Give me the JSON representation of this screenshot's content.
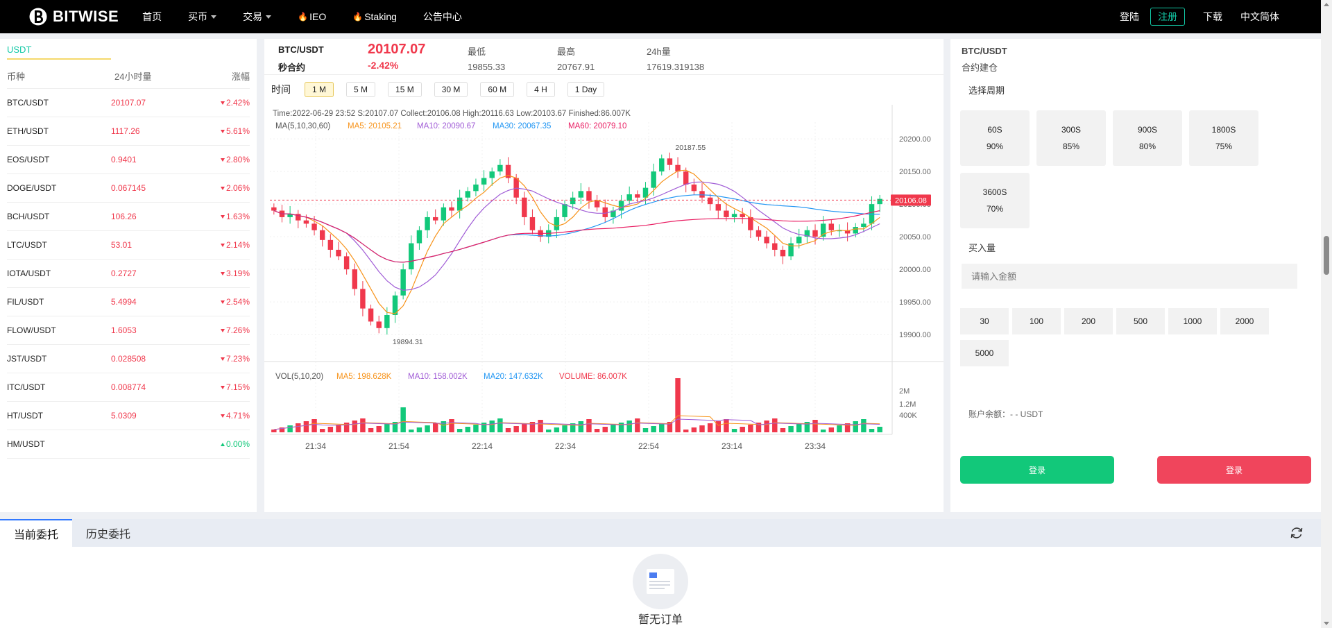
{
  "nav": {
    "logo_text": "BITWISE",
    "items": [
      {
        "label": "首页",
        "caret": false,
        "fire": false
      },
      {
        "label": "买币",
        "caret": true,
        "fire": false
      },
      {
        "label": "交易",
        "caret": true,
        "fire": false
      },
      {
        "label": "IEO",
        "caret": false,
        "fire": true
      },
      {
        "label": "Staking",
        "caret": false,
        "fire": true
      },
      {
        "label": "公告中心",
        "caret": false,
        "fire": false
      }
    ],
    "login": "登陆",
    "register": "注册",
    "download": "下载",
    "language": "中文简体"
  },
  "market": {
    "tab": "USDT",
    "headers": {
      "symbol": "币种",
      "volume": "24小时量",
      "change": "涨幅"
    },
    "rows": [
      {
        "symbol": "BTC/USDT",
        "price": "20107.07",
        "change": "2.42%",
        "dir": "down"
      },
      {
        "symbol": "ETH/USDT",
        "price": "1117.26",
        "change": "5.61%",
        "dir": "down"
      },
      {
        "symbol": "EOS/USDT",
        "price": "0.9401",
        "change": "2.80%",
        "dir": "down"
      },
      {
        "symbol": "DOGE/USDT",
        "price": "0.067145",
        "change": "2.06%",
        "dir": "down"
      },
      {
        "symbol": "BCH/USDT",
        "price": "106.26",
        "change": "1.63%",
        "dir": "down"
      },
      {
        "symbol": "LTC/USDT",
        "price": "53.01",
        "change": "2.14%",
        "dir": "down"
      },
      {
        "symbol": "IOTA/USDT",
        "price": "0.2727",
        "change": "3.19%",
        "dir": "down"
      },
      {
        "symbol": "FIL/USDT",
        "price": "5.4994",
        "change": "2.54%",
        "dir": "down"
      },
      {
        "symbol": "FLOW/USDT",
        "price": "1.6053",
        "change": "7.26%",
        "dir": "down"
      },
      {
        "symbol": "JST/USDT",
        "price": "0.028508",
        "change": "7.23%",
        "dir": "down"
      },
      {
        "symbol": "ITC/USDT",
        "price": "0.008774",
        "change": "7.15%",
        "dir": "down"
      },
      {
        "symbol": "HT/USDT",
        "price": "5.0309",
        "change": "4.71%",
        "dir": "down"
      },
      {
        "symbol": "HM/USDT",
        "price": "",
        "change": "0.00%",
        "dir": "up"
      }
    ]
  },
  "ticker": {
    "pair": "BTC/USDT",
    "type": "秒合约",
    "last": "20107.07",
    "change_pct": "-2.42%",
    "low_label": "最低",
    "low": "19855.33",
    "high_label": "最高",
    "high": "20767.91",
    "vol_label": "24h量",
    "vol": "17619.319138"
  },
  "timeframes": {
    "label": "时间",
    "items": [
      "1 M",
      "5 M",
      "15 M",
      "30 M",
      "60 M",
      "4 H",
      "1 Day"
    ],
    "active": "1 M"
  },
  "chart_data": {
    "type": "candlestick",
    "info_line": "Time:2022-06-29 23:52    S:20107.07    Collect:20106.08    High:20116.63    Low:20103.67  Finished:86.007K",
    "ma_label": "MA(5,10,30,60)",
    "ma_values": [
      {
        "label": "MA5: 20105.21",
        "color": "#f7931a"
      },
      {
        "label": "MA10: 20090.67",
        "color": "#a05cd6"
      },
      {
        "label": "MA30: 20067.35",
        "color": "#2196f3"
      },
      {
        "label": "MA60: 20079.10",
        "color": "#e91e63"
      }
    ],
    "y_ticks": [
      "20200.00",
      "20150.00",
      "20100.00",
      "20050.00",
      "20000.00",
      "19950.00",
      "19900.00"
    ],
    "y_range": [
      19880,
      20215
    ],
    "x_ticks": [
      "21:34",
      "21:54",
      "22:14",
      "22:34",
      "22:54",
      "23:14",
      "23:34"
    ],
    "current_price": "20106.08",
    "max_label": "20187.55",
    "min_label": "19894.31",
    "closes": [
      20090,
      20080,
      20085,
      20075,
      20070,
      20060,
      20045,
      20030,
      20020,
      20000,
      19970,
      19940,
      19920,
      19910,
      19930,
      19960,
      20000,
      20040,
      20060,
      20080,
      20075,
      20095,
      20090,
      20110,
      20120,
      20130,
      20140,
      20150,
      20160,
      20140,
      20110,
      20080,
      20060,
      20050,
      20060,
      20080,
      20100,
      20110,
      20120,
      20105,
      20095,
      20080,
      20090,
      20105,
      20115,
      20110,
      20125,
      20150,
      20170,
      20160,
      20150,
      20130,
      20120,
      20110,
      20100,
      20090,
      20080,
      20085,
      20080,
      20060,
      20050,
      20040,
      20030,
      20020,
      20040,
      20050,
      20060,
      20050,
      20070,
      20060,
      20060,
      20055,
      20065,
      20070,
      20100,
      20108
    ],
    "vol_label": "VOL(5,10,20)",
    "vol_values": [
      {
        "label": "MA5: 198.628K",
        "color": "#f7931a"
      },
      {
        "label": "MA10: 158.002K",
        "color": "#a05cd6"
      },
      {
        "label": "MA20: 147.632K",
        "color": "#2196f3"
      },
      {
        "label": "VOLUME: 86.007K",
        "color": "#f0384c"
      }
    ],
    "vol_ticks": [
      "2M",
      "1.2M",
      "400K"
    ]
  },
  "trade": {
    "pair": "BTC/USDT",
    "sub": "合约建仓",
    "period_label": "选择周期",
    "periods": [
      {
        "time": "60S",
        "rate": "90%"
      },
      {
        "time": "300S",
        "rate": "85%"
      },
      {
        "time": "900S",
        "rate": "80%"
      },
      {
        "time": "1800S",
        "rate": "75%"
      },
      {
        "time": "3600S",
        "rate": "70%"
      }
    ],
    "amount_label": "买入量",
    "amount_placeholder": "请输入金额",
    "amounts": [
      "30",
      "100",
      "200",
      "500",
      "1000",
      "2000",
      "5000"
    ],
    "balance": "账户余额：- - USDT",
    "buy_label": "登录",
    "sell_label": "登录"
  },
  "orders": {
    "tab_current": "当前委托",
    "tab_history": "历史委托",
    "empty_text": "暂无订单"
  }
}
